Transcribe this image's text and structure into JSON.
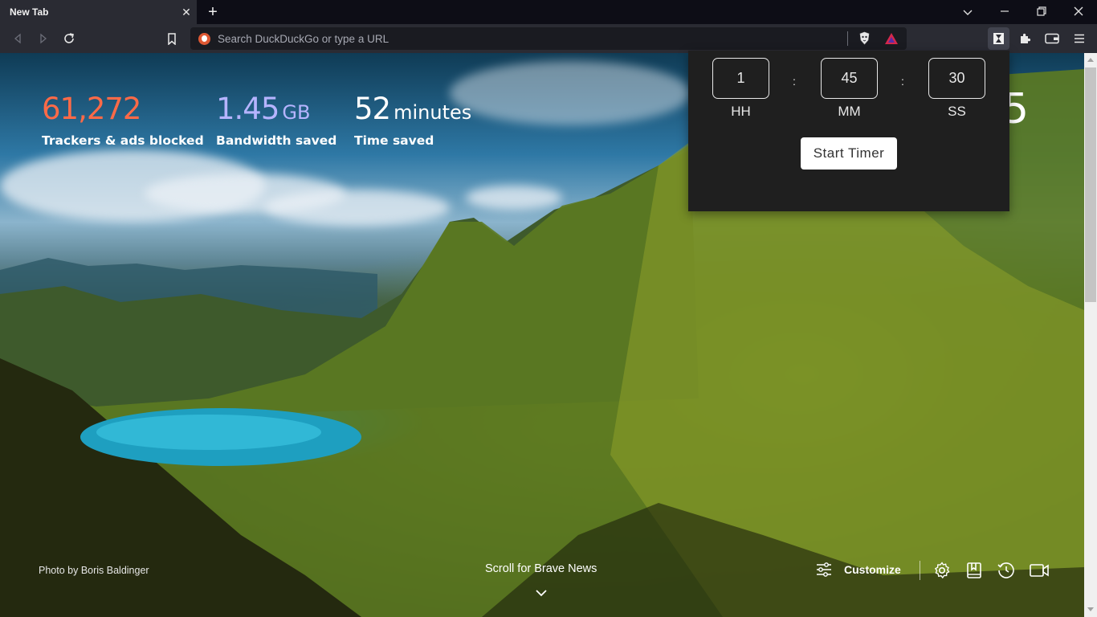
{
  "browser": {
    "tab_title": "New Tab",
    "tab_close": "✕",
    "new_tab": "+",
    "address_placeholder": "Search DuckDuckGo or type a URL"
  },
  "stats": {
    "trackers_value": "61,272",
    "trackers_label": "Trackers & ads blocked",
    "bandwidth_value": "1.45",
    "bandwidth_unit": "GB",
    "bandwidth_label": "Bandwidth saved",
    "time_value": "52",
    "time_unit": "minutes",
    "time_label": "Time saved"
  },
  "colors": {
    "trackers": "#ff6a47",
    "bandwidth": "#b6b4ff",
    "time": "#ffffff"
  },
  "timer": {
    "hours": "1",
    "minutes": "45",
    "seconds": "30",
    "hours_label": "HH",
    "minutes_label": "MM",
    "seconds_label": "SS",
    "separator": ":",
    "start_label": "Start Timer"
  },
  "footer": {
    "photo_credit": "Photo by Boris Baldinger",
    "scroll_news": "Scroll for Brave News",
    "customize_label": "Customize"
  },
  "clock_fragment": "5"
}
